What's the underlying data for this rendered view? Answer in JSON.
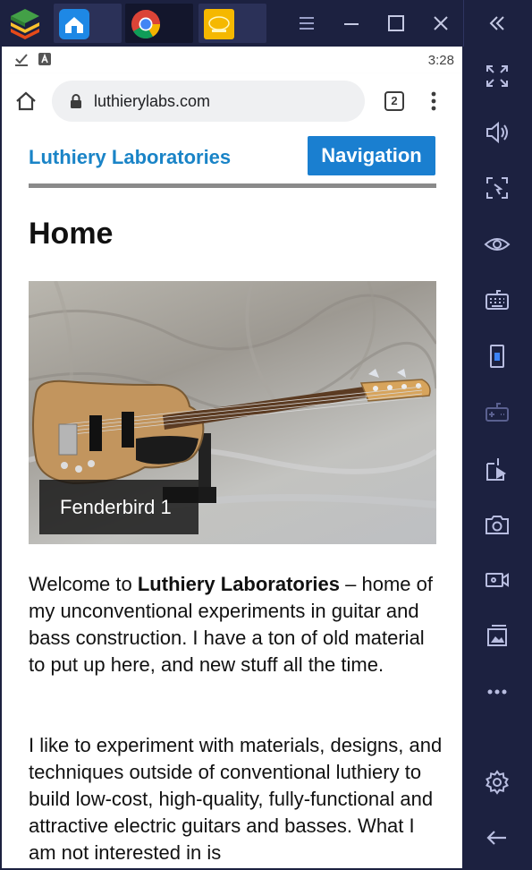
{
  "emulator": {
    "taskbar": [
      "home-app",
      "chrome",
      "seeplus-app"
    ],
    "sidebar": [
      "fullscreen",
      "volume",
      "screen-select",
      "view",
      "keyboard",
      "rotate",
      "gamepad",
      "install-apk",
      "screenshot",
      "record",
      "media",
      "more",
      "settings",
      "back"
    ]
  },
  "status": {
    "time": "3:28"
  },
  "browser": {
    "url": "luthierylabs.com",
    "tab_count": "2"
  },
  "page": {
    "site_title": "Luthiery Laboratories",
    "nav_label": "Navigation",
    "heading": "Home",
    "image_caption": "Fenderbird 1",
    "para1_prefix": "Welcome to ",
    "para1_bold": "Luthiery Laboratories",
    "para1_suffix": " – home of my unconventional experiments in guitar and bass construction. I have a ton of old material to put up here, and new stuff all the time.",
    "para2": "I like to experiment with materials, designs, and techniques outside of conventional luthiery to build low-cost, high-quality, fully-functional and attractive electric guitars and basses. What I am not interested in is"
  },
  "colors": {
    "link_blue": "#1a84c7",
    "nav_button": "#1a7fd0",
    "emulator_bg": "#1c2140"
  }
}
